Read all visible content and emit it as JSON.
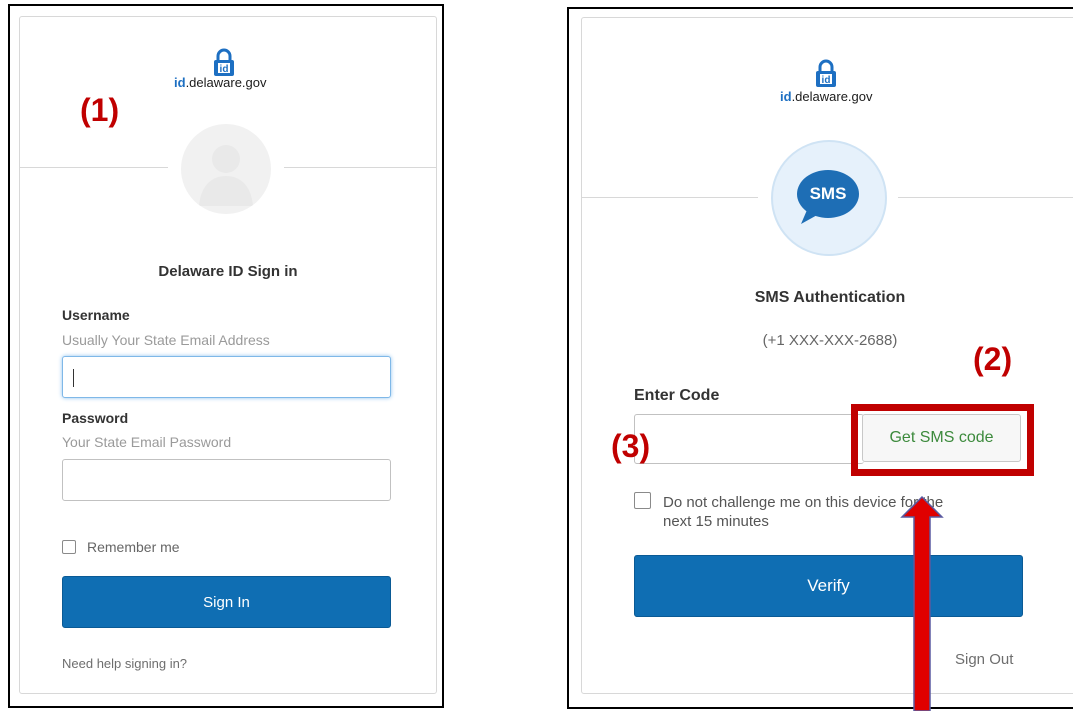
{
  "left_panel": {
    "annotation": "(1)",
    "logo": {
      "id_text": "id",
      "domain_text": ".delaware.gov",
      "icon": "padlock-id-icon"
    },
    "avatar_icon": "user-silhouette-icon",
    "title": "Delaware ID Sign in",
    "username_label": "Username",
    "username_hint": "Usually Your State Email Address",
    "username_value": "",
    "password_label": "Password",
    "password_hint": "Your State Email Password",
    "password_value": "",
    "remember_label": "Remember me",
    "sign_in_label": "Sign In",
    "help_link": "Need help signing in?"
  },
  "right_panel": {
    "annotation_code_field": "(3)",
    "annotation_button": "(2)",
    "logo": {
      "id_text": "id",
      "domain_text": ".delaware.gov",
      "icon": "padlock-id-icon"
    },
    "badge_text": "SMS",
    "title": "SMS Authentication",
    "phone": "(+1 XXX-XXX-2688)",
    "code_label": "Enter Code",
    "code_value": "",
    "get_code_label": "Get SMS code",
    "dont_challenge_line1": "Do not challenge me on this device for the",
    "dont_challenge_line2": "next 15 minutes",
    "verify_label": "Verify",
    "sign_out_label": "Sign Out"
  },
  "colors": {
    "primary_button": "#0f6eb3",
    "annotation_red": "#c00000",
    "get_code_text": "#3c8a3c",
    "sms_badge": "#1e6eb5"
  }
}
